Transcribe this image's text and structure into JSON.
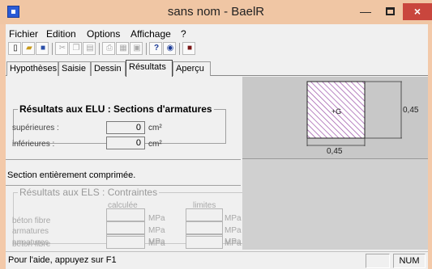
{
  "window": {
    "title": "sans nom - BaelR",
    "min_glyph": "—",
    "close_glyph": "×"
  },
  "menu": [
    "Fichier",
    "Edition",
    "Options",
    "Affichage",
    "?"
  ],
  "toolbar_icons": [
    "new-icon",
    "open-icon",
    "save-icon",
    "cut-icon",
    "copy-icon",
    "paste-icon",
    "print-icon",
    "print-preview-icon",
    "page-setup-icon",
    "help-icon",
    "info-icon",
    "stop-icon"
  ],
  "tabs": [
    "Hypothèses",
    "Saisie",
    "Dessin",
    "Résultats",
    "Aperçu"
  ],
  "active_tab": "Résultats",
  "elu": {
    "title": "Résultats aux ELU : Sections d'armatures",
    "rows": [
      {
        "label": "supérieures :",
        "value": "0",
        "unit": "cm²"
      },
      {
        "label": "inférieures :",
        "value": "0",
        "unit": "cm²"
      }
    ],
    "message": "Section entièrement comprimée."
  },
  "els": {
    "title": "Résultats aux ELS : Contraintes",
    "col_calculee": "calculée",
    "col_limites": "limites",
    "rows": [
      {
        "label": "béton fibre",
        "unit1": "MPa",
        "unit2": "MPa"
      },
      {
        "label": "armatures",
        "unit1": "MPa",
        "unit2": "MPa"
      },
      {
        "label": "armatures",
        "unit1": "MPa",
        "unit2": "MPa"
      },
      {
        "label": "béton fibre",
        "unit1": "MPa",
        "unit2": "MPa"
      }
    ]
  },
  "drawing": {
    "height_label": "0,45",
    "width_label": "0,45",
    "centroid_label": "G"
  },
  "statusbar": {
    "help_text": "Pour l'aide, appuyez sur F1",
    "num": "NUM"
  }
}
